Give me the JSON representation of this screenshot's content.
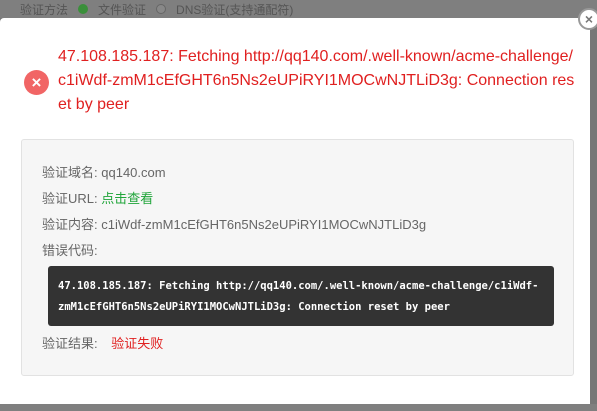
{
  "background": {
    "method_label": "验证方法",
    "option_file": "文件验证",
    "option_dns": "DNS验证(支持通配符)"
  },
  "modal": {
    "close_symbol": "×",
    "error_icon_symbol": "×",
    "error_title": "47.108.185.187: Fetching http://qq140.com/.well-known/acme-challenge/c1iWdf-zmM1cEfGHT6n5Ns2eUPiRYI1MOCwNJTLiD3g: Connection reset by peer",
    "details": {
      "domain_label": "验证域名:",
      "domain_value": "qq140.com",
      "url_label": "验证URL:",
      "url_link": "点击查看",
      "content_label": "验证内容:",
      "content_value": "c1iWdf-zmM1cEfGHT6n5Ns2eUPiRYI1MOCwNJTLiD3g",
      "error_code_label": "错误代码:",
      "error_code_value": "47.108.185.187: Fetching http://qq140.com/.well-known/acme-challenge/c1iWdf-zmM1cEfGHT6n5Ns2eUPiRYI1MOCwNJTLiD3g: Connection reset by peer",
      "result_label": "验证结果:",
      "result_value": "验证失败"
    }
  },
  "colors": {
    "error_red": "#e02020",
    "link_green": "#20a53a",
    "code_bg": "#333333"
  }
}
